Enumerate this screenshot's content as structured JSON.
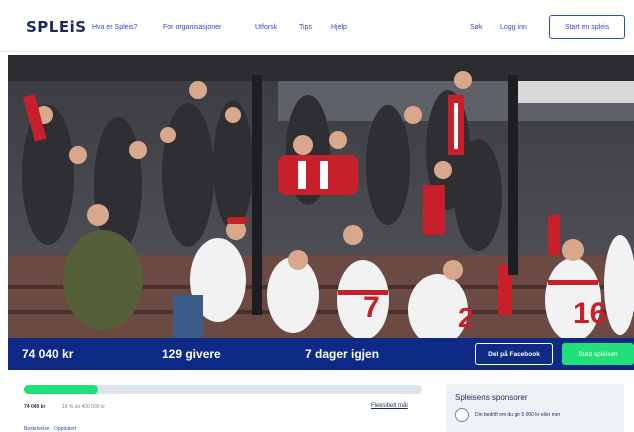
{
  "header": {
    "logo": "SPLEiS",
    "nav": [
      "Hva er Spleis?",
      "For organisasjoner",
      "Utforsk",
      "Tips",
      "Hjelp"
    ],
    "search_label": "Søk",
    "login_label": "Logg inn",
    "start_label": "Start en spleis"
  },
  "hero": {
    "jersey_numbers": [
      "7",
      "2",
      "16"
    ]
  },
  "stats": {
    "amount": "74 040 kr",
    "donors": "129 givere",
    "days_left": "7 dager igjen",
    "facebook_label": "Del på Facebook",
    "support_label": "Støtt spleisen"
  },
  "progress": {
    "fraction": 0.185,
    "raised": "74 040 kr",
    "subtitle": "18 % av 400 000 kr",
    "flex_goal": "Fleksibelt mål"
  },
  "content": {
    "description_label": "Beskrivelse · Oppdatert"
  },
  "sponsor": {
    "title": "Spleisens sponsorer",
    "text": "Din bedrift om du gir 5 000 kr eller mer"
  },
  "colors": {
    "brand_navy": "#0e2a87",
    "brand_green": "#21e07a",
    "link_blue": "#2e4db8"
  }
}
